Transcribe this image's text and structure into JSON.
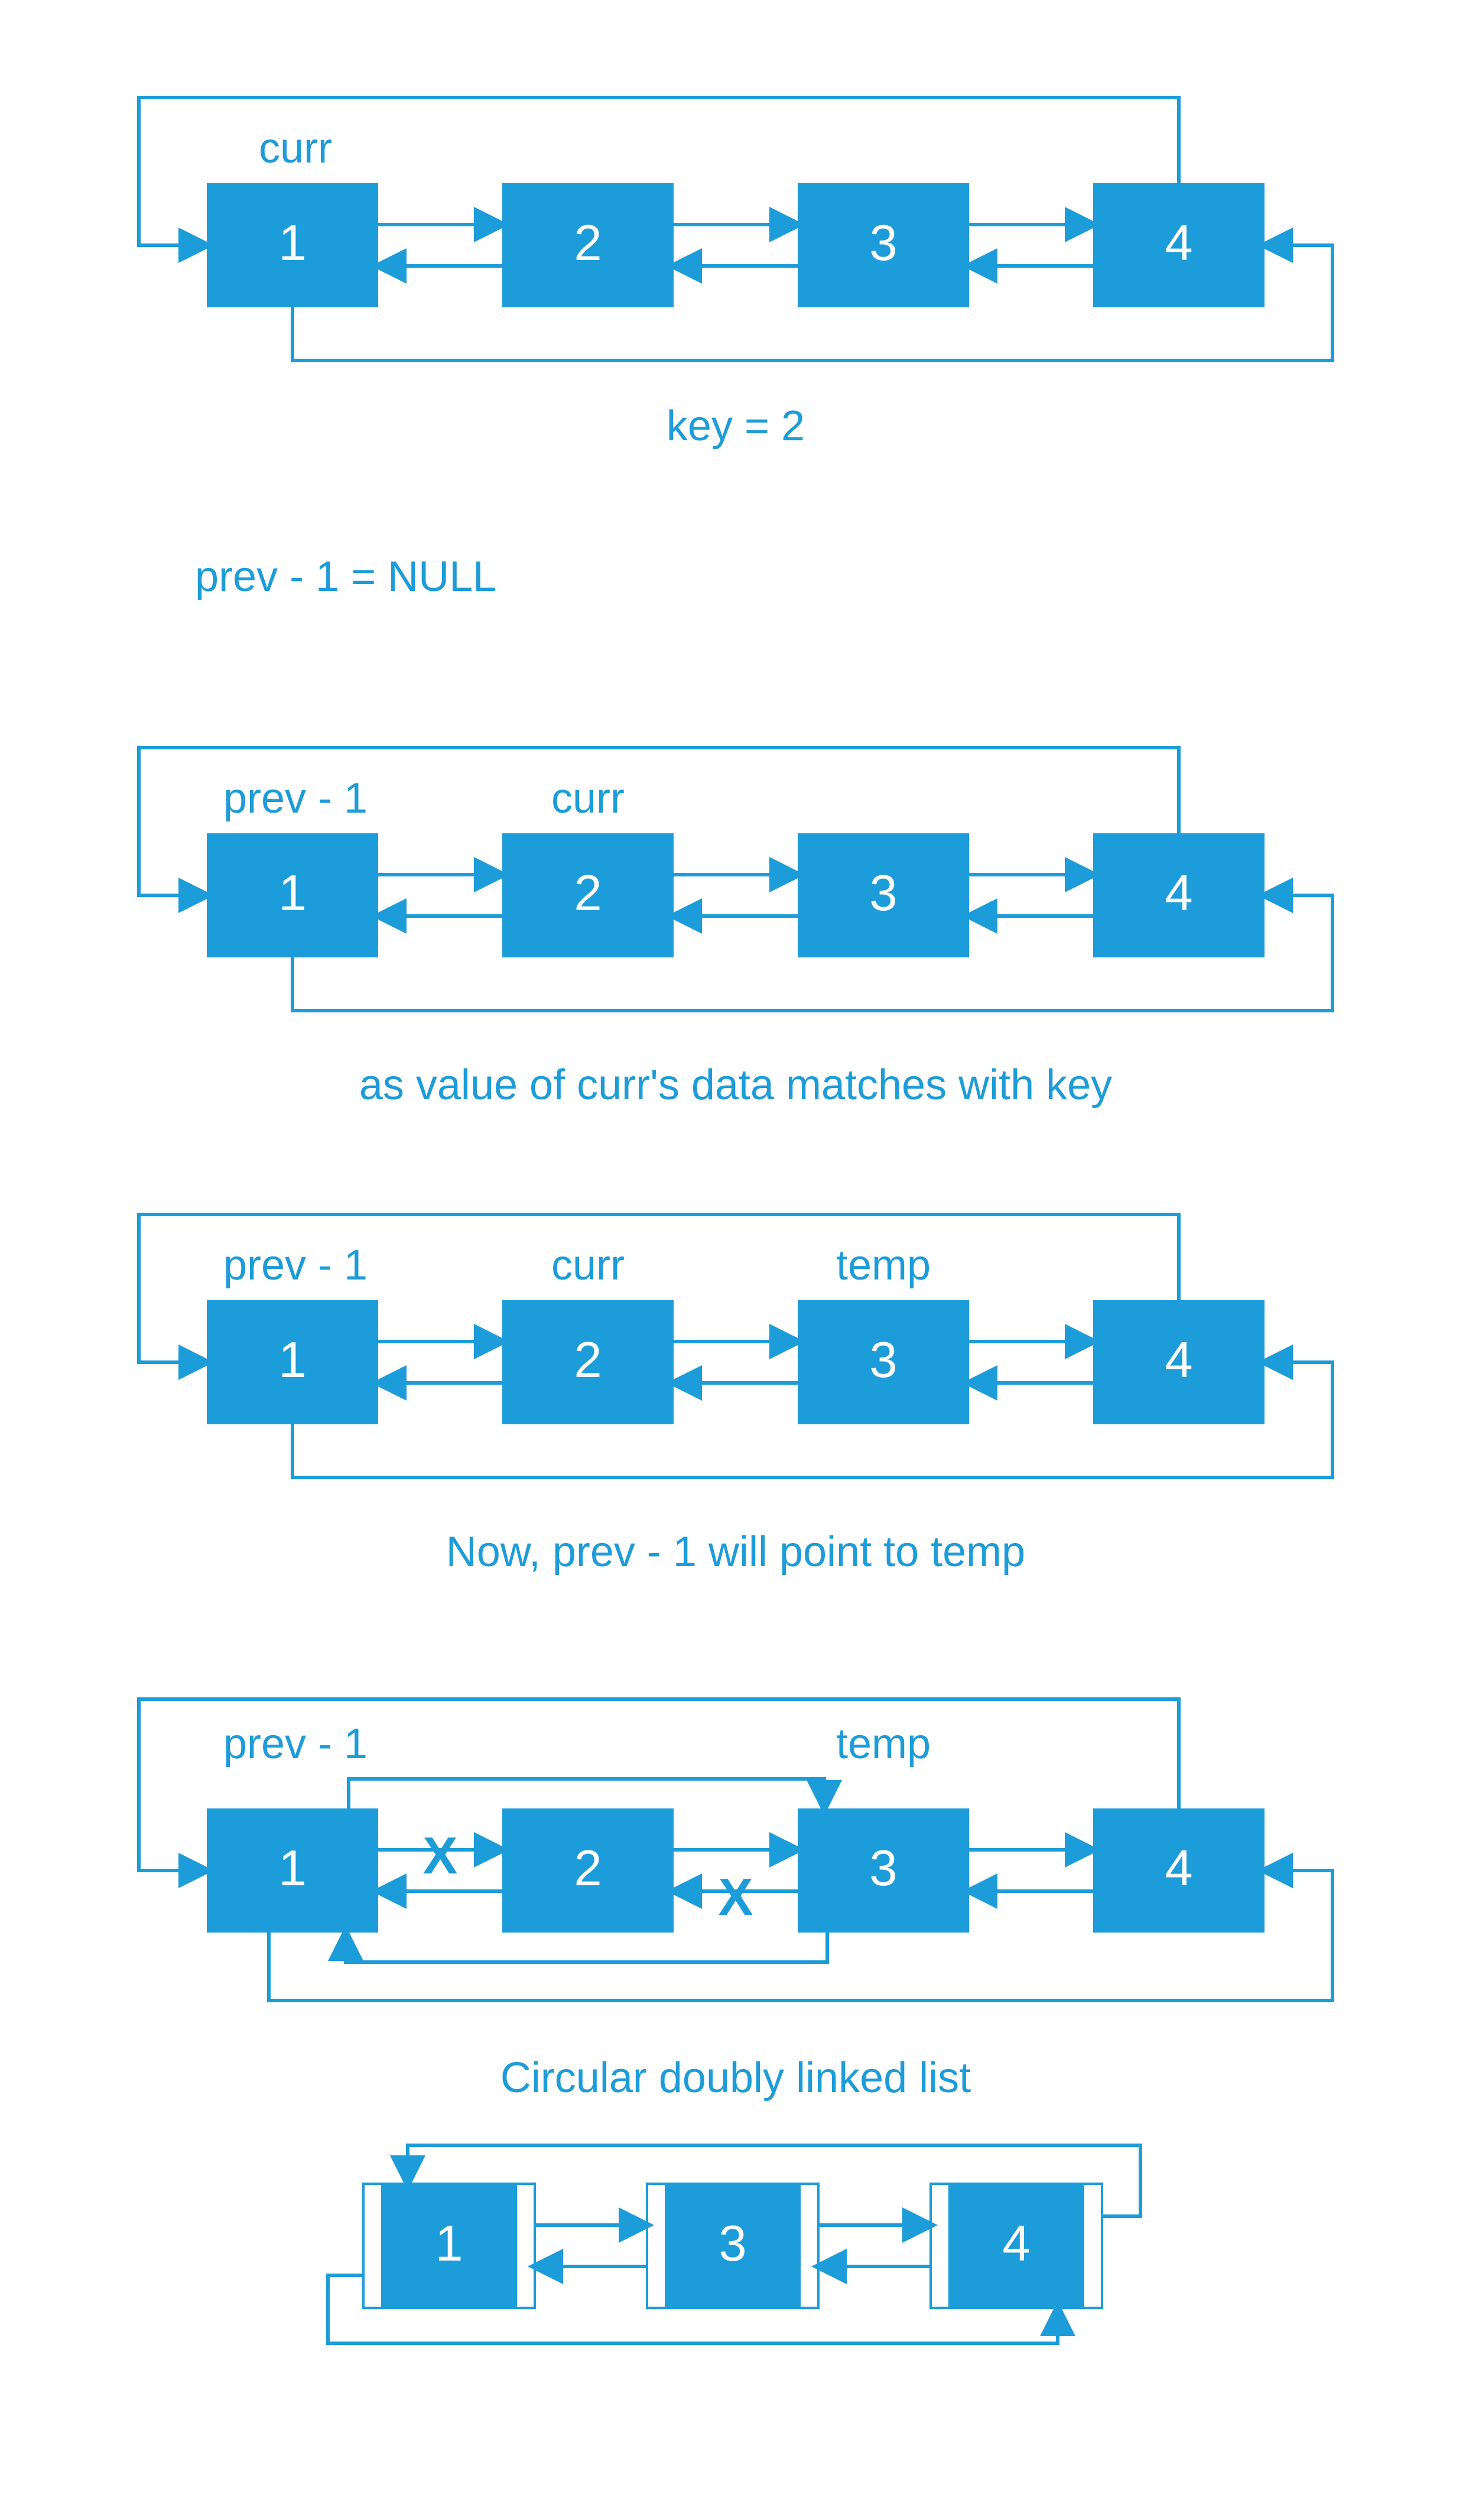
{
  "color": "#1C9CD8",
  "step1": {
    "label": "curr",
    "nodes": [
      "1",
      "2",
      "3",
      "4"
    ],
    "key_label": "key = 2"
  },
  "step2": {
    "prev_null": "prev - 1 = NULL",
    "labels": [
      "prev - 1",
      "curr"
    ],
    "nodes": [
      "1",
      "2",
      "3",
      "4"
    ],
    "caption": "as value of curr's data matches with key"
  },
  "step3": {
    "labels": [
      "prev - 1",
      "curr",
      "temp"
    ],
    "nodes": [
      "1",
      "2",
      "3",
      "4"
    ],
    "caption": "Now, prev - 1 will point to temp"
  },
  "step4": {
    "labels": [
      "prev - 1",
      "temp"
    ],
    "nodes": [
      "1",
      "2",
      "3",
      "4"
    ],
    "x": "X",
    "caption": "Circular doubly linked list"
  },
  "step5": {
    "nodes": [
      "1",
      "3",
      "4"
    ]
  }
}
